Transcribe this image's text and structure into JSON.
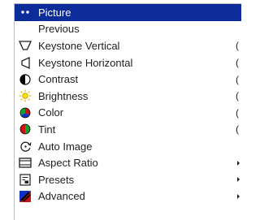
{
  "menu": {
    "items": [
      {
        "label": "Picture",
        "icon": "dots-icon",
        "selected": true,
        "suffix": "",
        "submenu": false
      },
      {
        "label": "Previous",
        "icon": "",
        "selected": false,
        "suffix": "",
        "submenu": false
      },
      {
        "label": "Keystone Vertical",
        "icon": "keystone-vertical-icon",
        "selected": false,
        "suffix": "(",
        "submenu": false
      },
      {
        "label": "Keystone Horizontal",
        "icon": "keystone-horizontal-icon",
        "selected": false,
        "suffix": "(",
        "submenu": false
      },
      {
        "label": "Contrast",
        "icon": "contrast-icon",
        "selected": false,
        "suffix": "(",
        "submenu": false
      },
      {
        "label": "Brightness",
        "icon": "brightness-icon",
        "selected": false,
        "suffix": "(",
        "submenu": false
      },
      {
        "label": "Color",
        "icon": "color-icon",
        "selected": false,
        "suffix": "(",
        "submenu": false
      },
      {
        "label": "Tint",
        "icon": "tint-icon",
        "selected": false,
        "suffix": "(",
        "submenu": false
      },
      {
        "label": "Auto Image",
        "icon": "auto-image-icon",
        "selected": false,
        "suffix": "",
        "submenu": false
      },
      {
        "label": "Aspect Ratio",
        "icon": "aspect-ratio-icon",
        "selected": false,
        "suffix": "",
        "submenu": true
      },
      {
        "label": "Presets",
        "icon": "presets-icon",
        "selected": false,
        "suffix": "",
        "submenu": true
      },
      {
        "label": "Advanced",
        "icon": "advanced-icon",
        "selected": false,
        "suffix": "",
        "submenu": true
      }
    ]
  },
  "colors": {
    "selected_bg": "#0c2c9a",
    "selected_text": "#ffffff",
    "text": "#1e1e1e"
  }
}
